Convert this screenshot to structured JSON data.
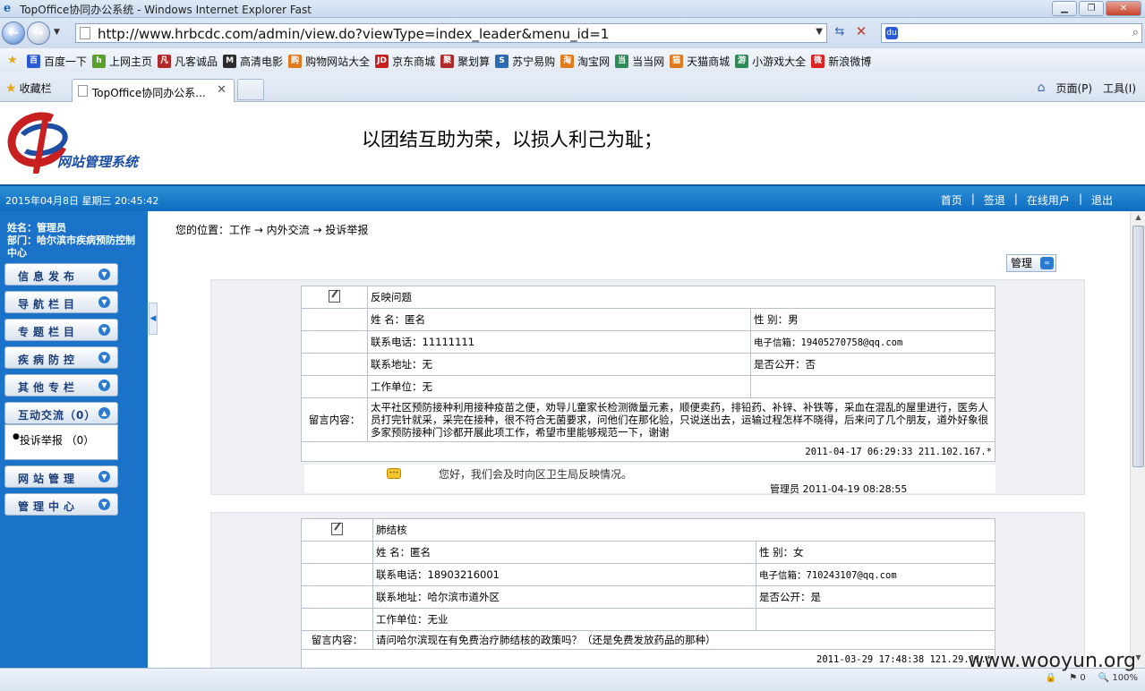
{
  "browser": {
    "window_title": "TopOffice协同办公系统 - Windows Internet Explorer Fast",
    "url": "http://www.hrbcdc.com/admin/view.do?viewType=index_leader&menu_id=1",
    "favorites_label": "收藏栏",
    "tab_title": "TopOffice协同办公系...",
    "command_page": "页面(P)",
    "command_tools": "工具(I)",
    "fav_links": [
      {
        "label": "百度一下",
        "color": "#2a5bd7",
        "glyph": "百"
      },
      {
        "label": "上网主页",
        "color": "#5aa02c",
        "glyph": "h"
      },
      {
        "label": "凡客诚品",
        "color": "#b02a2a",
        "glyph": "凡"
      },
      {
        "label": "高清电影",
        "color": "#2b2b2b",
        "glyph": "M"
      },
      {
        "label": "购物网站大全",
        "color": "#e07a1c",
        "glyph": "购"
      },
      {
        "label": "京东商城",
        "color": "#c81e1e",
        "glyph": "JD"
      },
      {
        "label": "聚划算",
        "color": "#b02a2a",
        "glyph": "聚"
      },
      {
        "label": "苏宁易购",
        "color": "#2a6ab0",
        "glyph": "S"
      },
      {
        "label": "淘宝网",
        "color": "#e07a1c",
        "glyph": "淘"
      },
      {
        "label": "当当网",
        "color": "#2e8b57",
        "glyph": "当"
      },
      {
        "label": "天猫商城",
        "color": "#e07a1c",
        "glyph": "猫"
      },
      {
        "label": "小游戏大全",
        "color": "#2e8b57",
        "glyph": "游"
      },
      {
        "label": "新浪微博",
        "color": "#d22",
        "glyph": "微"
      }
    ]
  },
  "site": {
    "logo_text": "网站管理系统",
    "slogan": "以团结互助为荣，以损人利己为耻；",
    "datetime": "2015年04月8日 星期三 20:45:42",
    "top_links": [
      "首页",
      "签退",
      "在线用户",
      "退出"
    ]
  },
  "sidebar": {
    "user_name": "姓名：管理员",
    "department": "部门：哈尔滨市疾病预防控制中心",
    "menu": [
      {
        "label": "信息发布"
      },
      {
        "label": "导航栏目"
      },
      {
        "label": "专题栏目"
      },
      {
        "label": "疾病防控"
      },
      {
        "label": "其他专栏"
      },
      {
        "label": "互动交流（0）"
      },
      {
        "label": "网站管理"
      },
      {
        "label": "管理中心"
      }
    ],
    "submenu_item": "投诉举报 （0）"
  },
  "content": {
    "breadcrumb": "您的位置：工作 → 内外交流 → 投诉举报",
    "manage_label": "管理",
    "entries": [
      {
        "subject": "反映问题",
        "name": "姓  名：匿名",
        "gender": "性  别：男",
        "phone": "联系电话：11111111",
        "email": "电子信箱：19405270758@qq.com",
        "address": "联系地址：无",
        "public": "是否公开：否",
        "workplace": "工作单位：无",
        "message_label": "留言内容：",
        "message": "太平社区预防接种利用接种疫苗之便，劝导儿童家长检测微量元素，顺便卖药，排铅药、补锌、补铁等，采血在混乱的屋里进行，医务人员打完针就采，采完在接种，很不符合无菌要求，问他们在那化验，只说送出去，运输过程怎样不晓得，后来问了几个朋友，道外好象很多家预防接种门诊都开展此项工作，希望市里能够规范一下，谢谢",
        "meta": "2011-04-17 06:29:33  211.102.167.*",
        "reply": "您好，我们会及时向区卫生局反映情况。",
        "reply_by": "管理员 2011-04-19 08:28:55"
      },
      {
        "subject": "肺结核",
        "name": "姓  名：匿名",
        "gender": "性  别：女",
        "phone": "联系电话：18903216001",
        "email": "电子信箱：710243107@qq.com",
        "address": "联系地址：哈尔滨市道外区",
        "public": "是否公开：是",
        "workplace": "工作单位：无业",
        "message_label": "留言内容：",
        "message": "请问哈尔滨现在有免费治疗肺结核的政策吗？（还是免费发放药品的那种）",
        "meta": "2011-03-29 17:48:38  121.29.11.*"
      }
    ]
  },
  "status": {
    "zoom": "100%",
    "count": "0"
  },
  "watermark": "www.wooyun.org"
}
